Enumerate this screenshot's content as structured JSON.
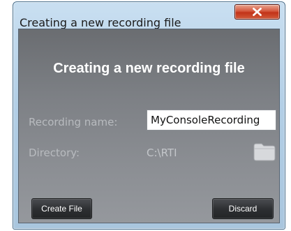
{
  "window": {
    "title": "Creating a new recording file",
    "close_icon": "close-x-icon"
  },
  "dialog": {
    "heading": "Creating a new recording file",
    "recording_name_label": "Recording name:",
    "recording_name_value": "MyConsoleRecording",
    "directory_label": "Directory:",
    "directory_value": "C:\\RTI",
    "folder_icon": "folder-icon",
    "create_button_label": "Create File",
    "discard_button_label": "Discard"
  },
  "colors": {
    "panel_gradient_top": "#6a6d71",
    "panel_gradient_bottom": "#95989d",
    "close_button": "#c23318",
    "button_dark": "#2c2e31"
  }
}
